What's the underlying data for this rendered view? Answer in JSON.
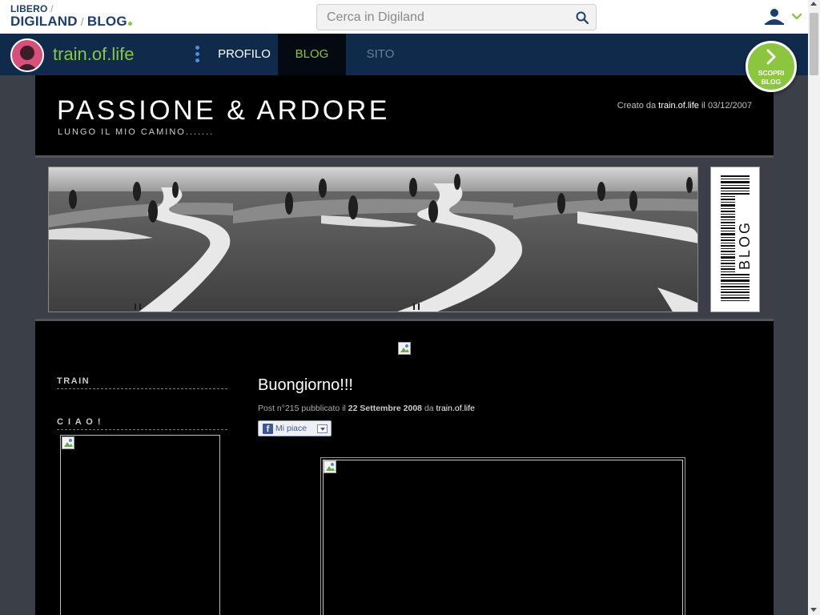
{
  "header": {
    "logo": {
      "line1": "LIBERO",
      "line1_sep": "/",
      "line2_a": "DIGILAND",
      "line2_sep": "/",
      "line2_b": "BLOG"
    },
    "search": {
      "placeholder": "Cerca in Digiland",
      "icon": "search-icon"
    },
    "user_menu": {
      "icon": "user-icon",
      "chevron": "chevron-down-icon"
    }
  },
  "nav": {
    "blog_name": "train.of.life",
    "menu_icon": "more-vertical-icon",
    "tabs": [
      {
        "label": "PROFILO"
      },
      {
        "label": "BLOG"
      },
      {
        "label": "SITO"
      }
    ],
    "discover_button": {
      "line1": "SCOPRI",
      "line2": "BLOG",
      "icon": "chevron-right-icon"
    }
  },
  "blog": {
    "title": "PASSIONE & ARDORE",
    "subtitle": "LUNGO IL MIO CAMINO.......",
    "created_prefix": "Creato da",
    "created_by": "train.of.life",
    "created_on_prefix": "il",
    "created_date": "03/12/2007",
    "banner_badge": "BLOG"
  },
  "sidebar": {
    "sections": [
      {
        "heading": "TRAIN"
      },
      {
        "heading": "C I A O !"
      }
    ]
  },
  "post": {
    "title": "Buongiorno!!!",
    "meta_prefix": "Post n°215 pubblicato il",
    "date": "22 Settembre 2008",
    "meta_author_prefix": "da",
    "author": "train.of.life",
    "like_label": "Mi piace"
  },
  "colors": {
    "accent_green": "#8cc63f",
    "nav_bg": "#0f2a4a",
    "brand_blue": "#1a3e6e",
    "page_bg": "#000000",
    "outer_bg": "#3a3f48"
  }
}
